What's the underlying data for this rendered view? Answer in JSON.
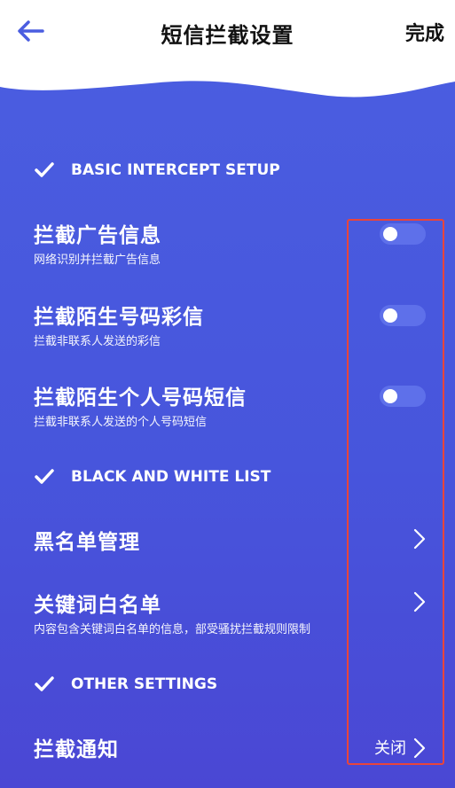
{
  "header": {
    "title": "短信拦截设置",
    "done_label": "完成"
  },
  "sections": [
    {
      "title": "BASIC INTERCEPT SETUP"
    },
    {
      "title": "BLACK AND WHITE LIST"
    },
    {
      "title": "OTHER SETTINGS"
    }
  ],
  "settings": [
    {
      "title": "拦截广告信息",
      "subtitle": "网络识别并拦截广告信息",
      "enabled": false
    },
    {
      "title": "拦截陌生号码彩信",
      "subtitle": "拦截非联系人发送的彩信",
      "enabled": false
    },
    {
      "title": "拦截陌生个人号码短信",
      "subtitle": "拦截非联系人发送的个人号码短信",
      "enabled": false
    }
  ],
  "lists": [
    {
      "title": "黑名单管理"
    },
    {
      "title": "关键词白名单",
      "subtitle": "内容包含关键词白名单的信息，部受骚扰拦截规则限制"
    }
  ],
  "other": {
    "notify_title": "拦截通知",
    "notify_value": "关闭"
  },
  "colors": {
    "background": "#4a55dc",
    "toggle_off": "#5e70ea",
    "highlight": "#e8453c"
  },
  "icons": {
    "back": "arrow-left-icon",
    "check": "check-icon",
    "chevron": "chevron-right-icon"
  }
}
